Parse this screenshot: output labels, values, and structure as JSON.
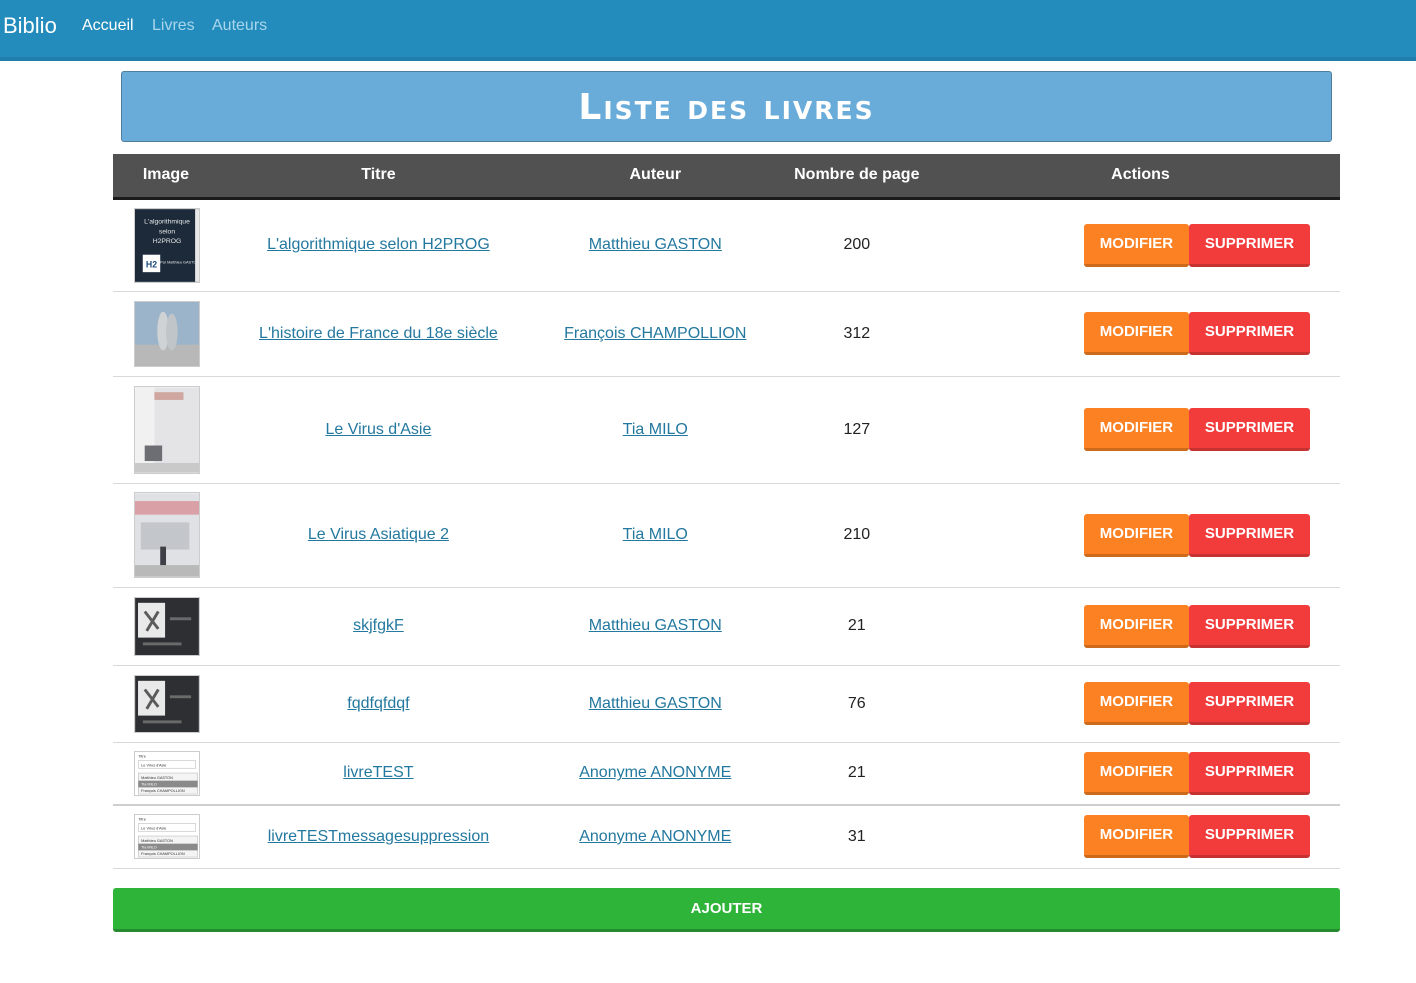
{
  "nav": {
    "brand": "Biblio",
    "links": [
      {
        "label": "Accueil"
      },
      {
        "label": "Livres"
      },
      {
        "label": "Auteurs"
      }
    ]
  },
  "page_title": "Liste des livres",
  "table": {
    "headers": [
      "Image",
      "Titre",
      "Auteur",
      "Nombre de page",
      "Actions"
    ],
    "rows": [
      {
        "title": "L'algorithmique selon H2PROG",
        "author": "Matthieu GASTON",
        "pages": "200",
        "thumb_lines": [
          "L'algorithmique",
          "selon",
          "H2PROG"
        ],
        "thumb_logo": "H2",
        "thumb_byline": "Par Matthieu GASTON"
      },
      {
        "title": "L'histoire de France du 18e siècle",
        "author": "François CHAMPOLLION",
        "pages": "312"
      },
      {
        "title": "Le Virus d'Asie",
        "author": "Tia MILO",
        "pages": "127"
      },
      {
        "title": "Le Virus Asiatique 2",
        "author": "Tia MILO",
        "pages": "210"
      },
      {
        "title": "skjfgkF",
        "author": "Matthieu GASTON",
        "pages": "21"
      },
      {
        "title": "fqdfqfdqf",
        "author": "Matthieu GASTON",
        "pages": "76"
      },
      {
        "title": "livreTEST",
        "author": "Anonyme ANONYME",
        "pages": "21",
        "thumb_lines": [
          "Titre",
          "Le Virus d'Asie",
          "Matthieu GASTON",
          "Tia MILO",
          "François CHAMPOLLION"
        ]
      },
      {
        "title": "livreTESTmessagesuppression",
        "author": "Anonyme ANONYME",
        "pages": "31",
        "thumb_lines": [
          "Titre",
          "Le Virus d'Asie",
          "Matthieu GASTON",
          "Tia MILO",
          "François CHAMPOLLION"
        ]
      }
    ]
  },
  "actions": {
    "modify_label": "MODIFIER",
    "delete_label": "SUPPRIMER"
  },
  "add_label": "AJOUTER",
  "colors": {
    "navbar": "#238cbc",
    "title_box": "#6aacd9",
    "header": "#515151",
    "modify": "#fb8122",
    "delete": "#f23c3c",
    "add": "#2fb43a",
    "link": "#23789f"
  }
}
